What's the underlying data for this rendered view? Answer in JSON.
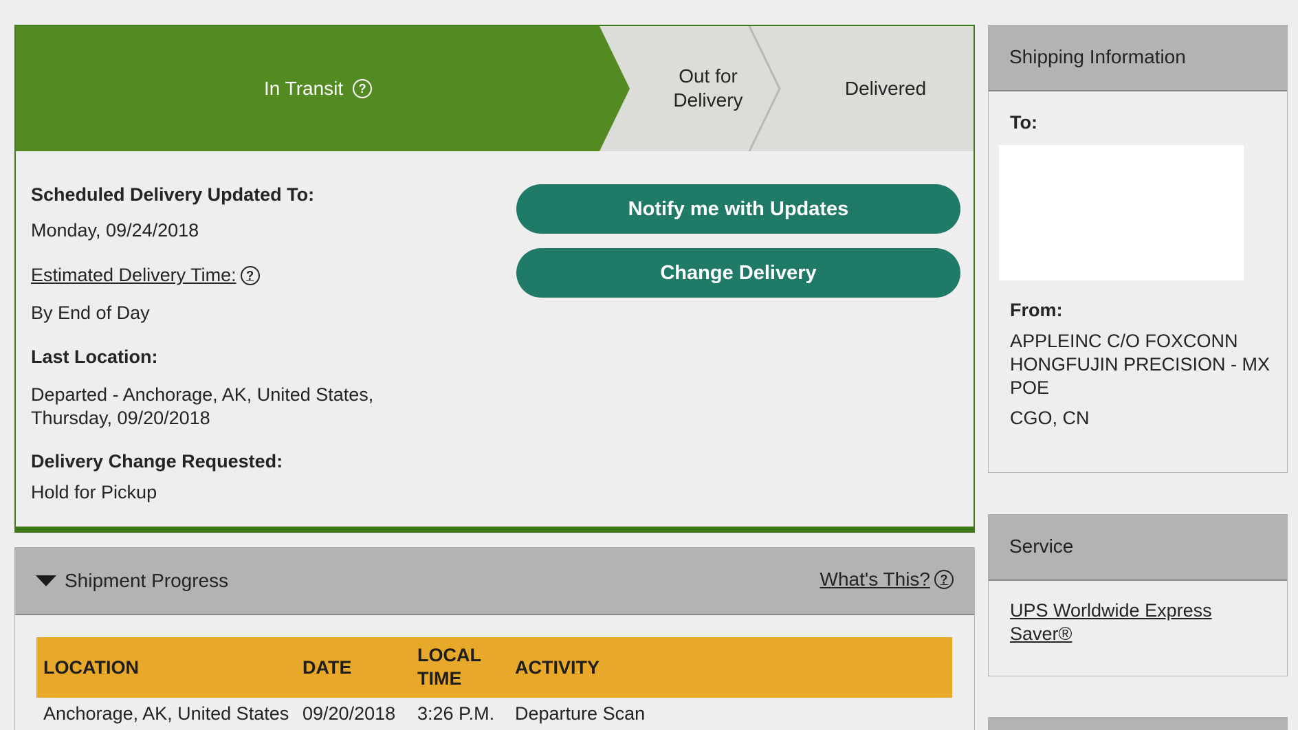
{
  "progress": {
    "steps": [
      {
        "label": "In Transit",
        "active": true
      },
      {
        "label": "Out for Delivery",
        "line1": "Out for",
        "line2": "Delivery",
        "active": false
      },
      {
        "label": "Delivered",
        "active": false
      }
    ],
    "colors": {
      "active": "#548a22",
      "inactive": "#dcdcd8",
      "border": "#3e7a1c"
    }
  },
  "delivery": {
    "scheduled_label": "Scheduled Delivery Updated To:",
    "scheduled_value": "Monday, 09/24/2018",
    "estimated_label": "Estimated Delivery Time:",
    "estimated_value": "By End of Day",
    "last_location_label": "Last Location:",
    "last_location_line1": "Departed - Anchorage, AK, United States,",
    "last_location_line2": "Thursday, 09/20/2018",
    "change_label": "Delivery Change Requested:",
    "change_value": "Hold for Pickup"
  },
  "buttons": {
    "notify": "Notify me with Updates",
    "change": "Change Delivery",
    "color": "#1f7a68"
  },
  "shipment_progress": {
    "title": "Shipment Progress",
    "whats_this": "What's This?",
    "header_color": "#e8a82a",
    "columns": {
      "location": "LOCATION",
      "date": "DATE",
      "time_line1": "LOCAL",
      "time_line2": "TIME",
      "activity": "ACTIVITY"
    },
    "rows": [
      {
        "location": "Anchorage,  AK,  United States",
        "date": "09/20/2018",
        "time": "3:26 P.M.",
        "activity": "Departure Scan"
      }
    ]
  },
  "shipping_info": {
    "title": "Shipping Information",
    "to_label": "To:",
    "from_label": "From:",
    "from_line1": "APPLEINC C/O FOXCONN",
    "from_line2": "HONGFUJIN PRECISION - MX",
    "from_line3": "POE",
    "from_city": "CGO,  CN"
  },
  "service": {
    "title": "Service",
    "line1": "UPS Worldwide Express",
    "line2": "Saver®"
  },
  "icons": {
    "help": "help-circle-icon",
    "caret": "caret-down-icon"
  }
}
